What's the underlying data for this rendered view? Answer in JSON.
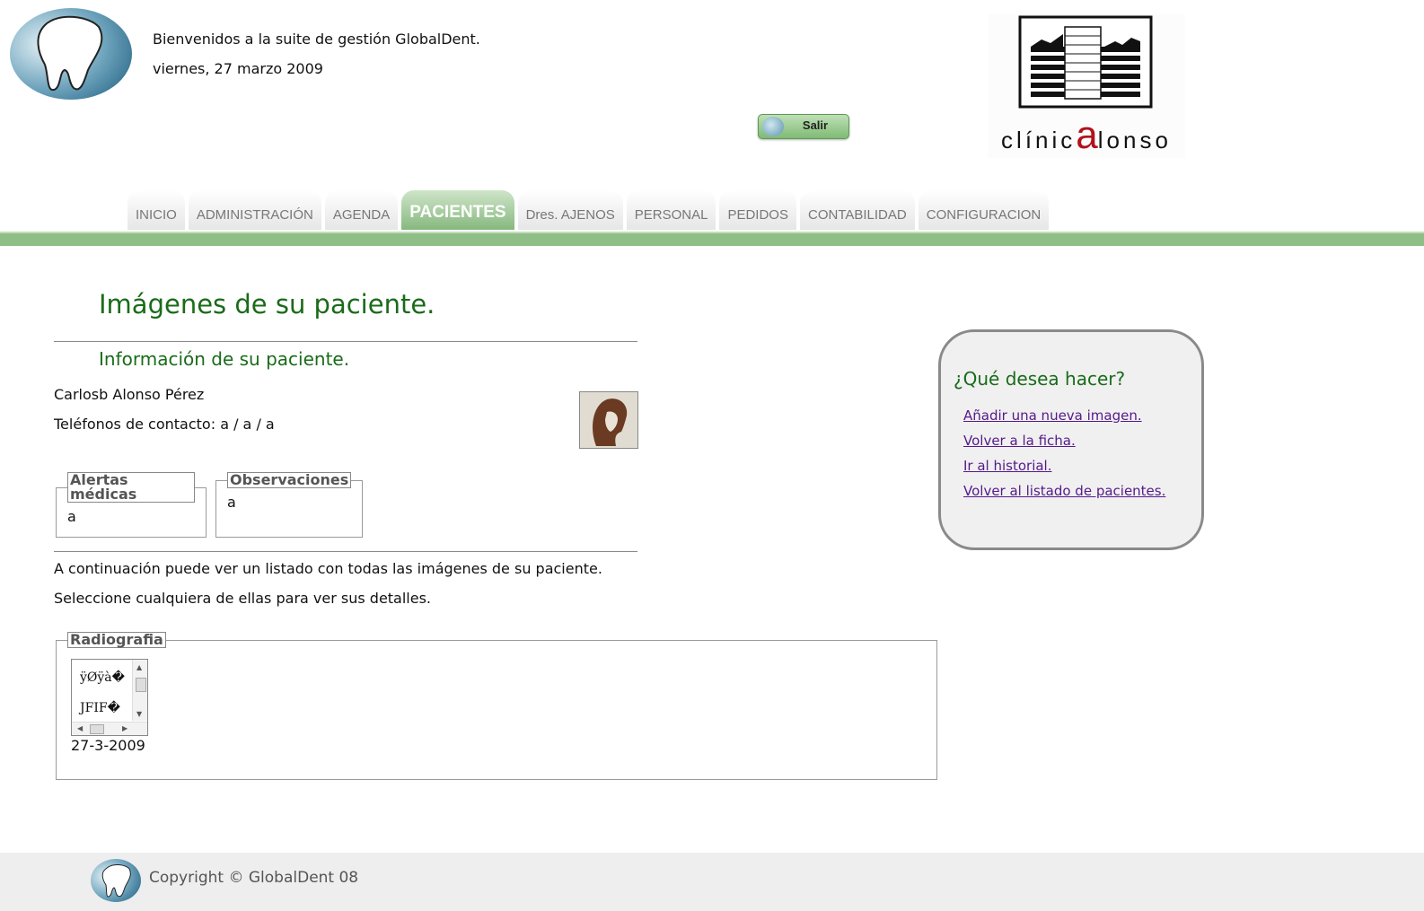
{
  "header": {
    "welcome": "Bienvenidos a la suite de gestión GlobalDent.",
    "date": "viernes, 27 marzo 2009",
    "logout_label": "Salir",
    "clinic_name_part1": "clínic",
    "clinic_name_big": "a",
    "clinic_name_part2": "lonso"
  },
  "nav": {
    "tabs": [
      {
        "label": "INICIO"
      },
      {
        "label": "ADMINISTRACIÓN"
      },
      {
        "label": "AGENDA"
      },
      {
        "label": "PACIENTES",
        "active": true
      },
      {
        "label": "Dres. AJENOS"
      },
      {
        "label": "PERSONAL"
      },
      {
        "label": "PEDIDOS"
      },
      {
        "label": "CONTABILIDAD"
      },
      {
        "label": "CONFIGURACION"
      }
    ]
  },
  "main": {
    "title": "Imágenes de su paciente.",
    "info_title": "Información de su paciente.",
    "patient_name": "Carlosb Alonso Pérez",
    "patient_phones": "Teléfonos de contacto: a / a / a",
    "alerts_legend": "Alertas médicas",
    "alerts_value": "a",
    "observations_legend": "Observaciones",
    "observations_value": "a",
    "intro_line1": "A continuación puede ver un listado con todas las imágenes de su paciente.",
    "intro_line2": "Seleccione cualquiera de ellas para ver sus detalles.",
    "image_group": {
      "legend": "Radiografia",
      "thumb_text_line1": "ÿØÿà�",
      "thumb_text_line2": "JFIF�",
      "date": "27-3-2009"
    }
  },
  "side_panel": {
    "title": "¿Qué desea hacer?",
    "links": [
      {
        "label": "Añadir una nueva imagen."
      },
      {
        "label": "Volver a la ficha."
      },
      {
        "label": "Ir al historial."
      },
      {
        "label": "Volver al listado de pacientes."
      }
    ]
  },
  "footer": {
    "copyright": "Copyright © GlobalDent 08"
  },
  "colors": {
    "accent_green": "#1a6b1a",
    "nav_bar": "#8fbe86",
    "link": "#551a8b",
    "clinic_red": "#b0121b"
  }
}
